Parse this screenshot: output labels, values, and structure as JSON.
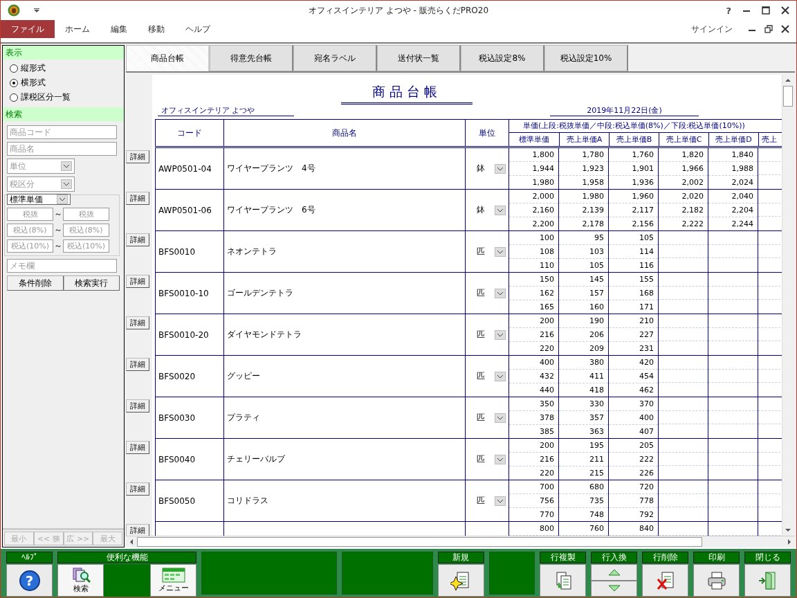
{
  "window": {
    "title": "オフィスインテリア よつや - 販売らくだPRO20",
    "help_glyph": "?"
  },
  "menu": [
    {
      "label": "ファイル",
      "selected": true
    },
    {
      "label": "ホーム",
      "selected": false
    },
    {
      "label": "編集",
      "selected": false
    },
    {
      "label": "移動",
      "selected": false
    },
    {
      "label": "ヘルプ",
      "selected": false
    }
  ],
  "account": {
    "label": "サインイン"
  },
  "sidebar": {
    "display": {
      "title": "表示",
      "options": [
        {
          "label": "縦形式",
          "selected": false
        },
        {
          "label": "横形式",
          "selected": true
        },
        {
          "label": "課税区分一覧",
          "selected": false
        }
      ]
    },
    "search": {
      "title": "検索",
      "fields": [
        {
          "kind": "text",
          "placeholder": "商品コード"
        },
        {
          "kind": "text",
          "placeholder": "商品名"
        },
        {
          "kind": "select",
          "placeholder": "単位"
        },
        {
          "kind": "select",
          "placeholder": "税区分"
        }
      ],
      "price_type": {
        "value": "標準単価"
      },
      "ranges": [
        {
          "from": {
            "placeholder": "税抜"
          },
          "separator": "～",
          "to": {
            "placeholder": "税抜"
          }
        },
        {
          "from": {
            "placeholder": "税込(8%)"
          },
          "separator": "～",
          "to": {
            "placeholder": "税込(8%)"
          }
        },
        {
          "from": {
            "placeholder": "税込(10%)"
          },
          "separator": "～",
          "to": {
            "placeholder": "税込(10%)"
          }
        }
      ],
      "memo": {
        "placeholder": "メモ欄"
      },
      "buttons": [
        "条件削除",
        "検索実行"
      ]
    },
    "nav": [
      {
        "label": "最小",
        "disabled": true
      },
      {
        "label": "<< 狭",
        "disabled": true
      },
      {
        "label": "広 >>",
        "disabled": true
      },
      {
        "label": "最大",
        "disabled": true
      }
    ]
  },
  "tabs": [
    {
      "label": "商品台帳",
      "selected": true
    },
    {
      "label": "得意先台帳",
      "selected": false
    },
    {
      "label": "宛名ラベル",
      "selected": false
    },
    {
      "label": "送付状一覧",
      "selected": false
    },
    {
      "label": "税込設定8%",
      "selected": false
    },
    {
      "label": "税込設定10%",
      "selected": false
    }
  ],
  "report": {
    "title": "商品台帳",
    "company": "オフィスインテリア よつや",
    "date": "2019年11月22日(金)",
    "columns": {
      "code": "コード",
      "name": "商品名",
      "unit": "単位",
      "price_group": "単価(上段:税抜単価／中段:税込単価(8%)／下段:税込単価(10%))",
      "prices": [
        "標準単価",
        "売上単価A",
        "売上単価B",
        "売上単価C",
        "売上単価D",
        "売上"
      ]
    },
    "rows": [
      {
        "detail": "詳細",
        "code": "AWP0501-04",
        "name": "ワイヤープランツ　4号",
        "unit": "鉢",
        "prices": [
          [
            "1,800",
            "1,944",
            "1,980"
          ],
          [
            "1,780",
            "1,923",
            "1,958"
          ],
          [
            "1,760",
            "1,901",
            "1,936"
          ],
          [
            "1,820",
            "1,966",
            "2,002"
          ],
          [
            "1,840",
            "1,988",
            "2,024"
          ]
        ]
      },
      {
        "detail": "詳細",
        "code": "AWP0501-06",
        "name": "ワイヤープランツ　6号",
        "unit": "鉢",
        "prices": [
          [
            "2,000",
            "2,160",
            "2,200"
          ],
          [
            "1,980",
            "2,139",
            "2,178"
          ],
          [
            "1,960",
            "2,117",
            "2,156"
          ],
          [
            "2,020",
            "2,182",
            "2,222"
          ],
          [
            "2,040",
            "2,204",
            "2,244"
          ]
        ]
      },
      {
        "detail": "詳細",
        "code": "BFS0010",
        "name": "ネオンテトラ",
        "unit": "匹",
        "prices": [
          [
            "100",
            "108",
            "110"
          ],
          [
            "95",
            "103",
            "105"
          ],
          [
            "105",
            "114",
            "116"
          ]
        ]
      },
      {
        "detail": "詳細",
        "code": "BFS0010-10",
        "name": "ゴールデンテトラ",
        "unit": "匹",
        "prices": [
          [
            "150",
            "162",
            "165"
          ],
          [
            "145",
            "157",
            "160"
          ],
          [
            "155",
            "168",
            "171"
          ]
        ]
      },
      {
        "detail": "詳細",
        "code": "BFS0010-20",
        "name": "ダイヤモンドテトラ",
        "unit": "匹",
        "prices": [
          [
            "200",
            "216",
            "220"
          ],
          [
            "190",
            "206",
            "209"
          ],
          [
            "210",
            "227",
            "231"
          ]
        ]
      },
      {
        "detail": "詳細",
        "code": "BFS0020",
        "name": "グッピー",
        "unit": "匹",
        "prices": [
          [
            "400",
            "432",
            "440"
          ],
          [
            "380",
            "411",
            "418"
          ],
          [
            "420",
            "454",
            "462"
          ]
        ]
      },
      {
        "detail": "詳細",
        "code": "BFS0030",
        "name": "プラティ",
        "unit": "匹",
        "prices": [
          [
            "350",
            "378",
            "385"
          ],
          [
            "330",
            "357",
            "363"
          ],
          [
            "370",
            "400",
            "407"
          ]
        ]
      },
      {
        "detail": "詳細",
        "code": "BFS0040",
        "name": "チェリーバルブ",
        "unit": "匹",
        "prices": [
          [
            "200",
            "216",
            "220"
          ],
          [
            "195",
            "211",
            "215"
          ],
          [
            "205",
            "222",
            "226"
          ]
        ]
      },
      {
        "detail": "詳細",
        "code": "BFS0050",
        "name": "コリドラス",
        "unit": "匹",
        "prices": [
          [
            "700",
            "756",
            "770"
          ],
          [
            "680",
            "735",
            "748"
          ],
          [
            "720",
            "778",
            "792"
          ]
        ]
      },
      {
        "detail": "詳細",
        "prices": [
          [
            "800"
          ],
          [
            "760"
          ],
          [
            "840"
          ]
        ]
      }
    ]
  },
  "toolbar": [
    {
      "kind": "group",
      "label": "ﾍﾙﾌﾟ",
      "glyph": "?"
    },
    {
      "kind": "group",
      "label": "便利な機能",
      "buttons": [
        {
          "kind": "button",
          "text": "検索"
        },
        {
          "kind": "blank"
        },
        {
          "kind": "button",
          "text": "メニュー"
        }
      ]
    },
    {
      "kind": "empty"
    },
    {
      "kind": "empty"
    },
    {
      "kind": "group",
      "label": "新規"
    },
    {
      "kind": "empty"
    },
    {
      "kind": "group",
      "label": "行複製"
    },
    {
      "kind": "group",
      "label": "行入換"
    },
    {
      "kind": "group",
      "label": "行削除"
    },
    {
      "kind": "group",
      "label": "印刷"
    },
    {
      "kind": "group",
      "label": "閉じる"
    }
  ]
}
